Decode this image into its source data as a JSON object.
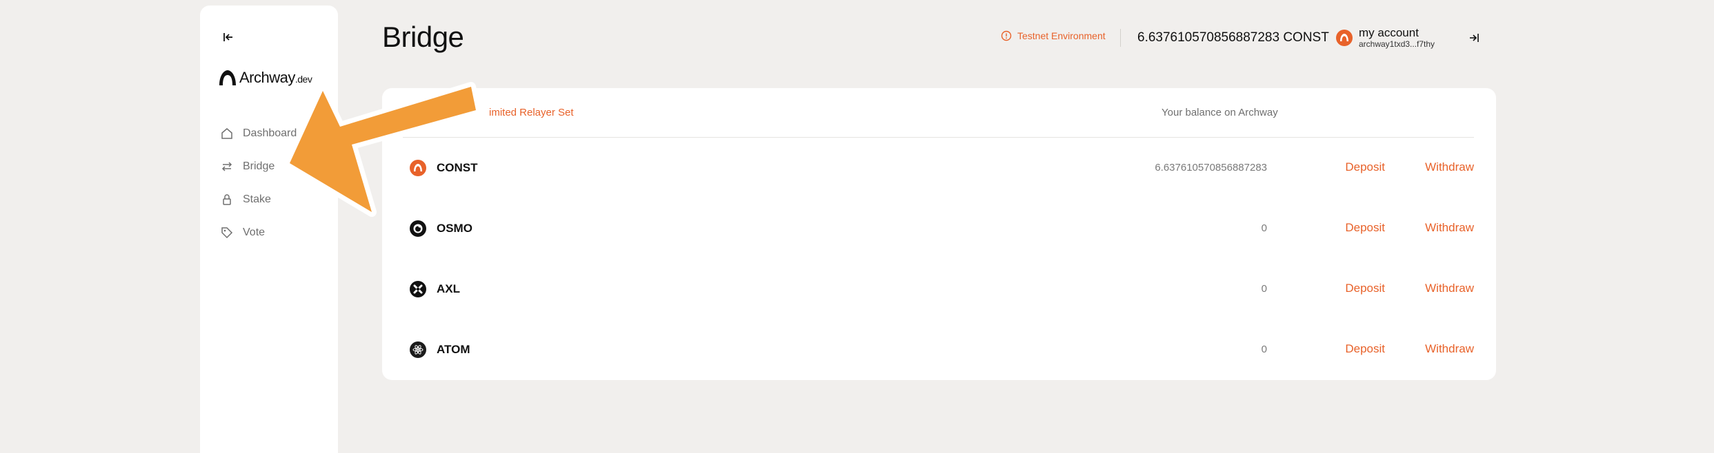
{
  "colors": {
    "accent": "#e8622a",
    "arrow": "#f29c38",
    "background": "#f1efed"
  },
  "sidebar": {
    "collapse_icon": "collapse-left-icon",
    "logo": {
      "name": "Archway",
      "suffix": ".dev"
    },
    "items": [
      {
        "label": "Dashboard",
        "icon": "home-icon"
      },
      {
        "label": "Bridge",
        "icon": "arrows-swap-icon"
      },
      {
        "label": "Stake",
        "icon": "lock-icon"
      },
      {
        "label": "Vote",
        "icon": "tag-icon"
      }
    ]
  },
  "header": {
    "title": "Bridge",
    "environment": "Testnet Environment",
    "balance": "6.637610570856887283 CONST",
    "account_name": "my account",
    "account_address": "archway1txd3...f7thy"
  },
  "table": {
    "link_label": "imited Relayer Set",
    "balance_header": "Your balance on Archway",
    "rows": [
      {
        "token": "CONST",
        "balance": "6.637610570856887283",
        "deposit": "Deposit",
        "withdraw": "Withdraw",
        "icon": "const-token-icon"
      },
      {
        "token": "OSMO",
        "balance": "0",
        "deposit": "Deposit",
        "withdraw": "Withdraw",
        "icon": "osmo-token-icon"
      },
      {
        "token": "AXL",
        "balance": "0",
        "deposit": "Deposit",
        "withdraw": "Withdraw",
        "icon": "axl-token-icon"
      },
      {
        "token": "ATOM",
        "balance": "0",
        "deposit": "Deposit",
        "withdraw": "Withdraw",
        "icon": "atom-token-icon"
      }
    ]
  }
}
